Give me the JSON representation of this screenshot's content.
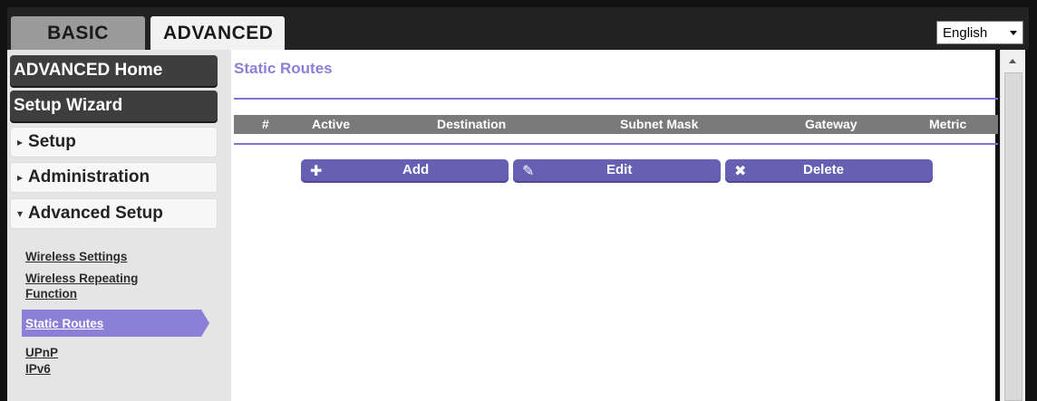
{
  "top_tabs": {
    "basic": "BASIC",
    "advanced": "ADVANCED"
  },
  "language": {
    "selected": "English"
  },
  "sidebar": {
    "advanced_home": "ADVANCED Home",
    "setup_wizard": "Setup Wizard",
    "setup": "Setup",
    "administration": "Administration",
    "advanced_setup": "Advanced Setup",
    "sub_items": [
      {
        "label": "Wireless Settings"
      },
      {
        "label": "Wireless Repeating"
      },
      {
        "label": "Function"
      },
      {
        "label": "Static Routes"
      },
      {
        "label": "UPnP"
      },
      {
        "label": "IPv6"
      }
    ]
  },
  "main": {
    "title": "Static Routes",
    "table_headers": [
      "#",
      "Active",
      "Destination",
      "Subnet Mask",
      "Gateway",
      "Metric"
    ],
    "buttons": {
      "add": "Add",
      "edit": "Edit",
      "delete": "Delete"
    }
  },
  "colors": {
    "accent": "#8c7fd8",
    "button": "#675fb1",
    "nav_dark": "#3e3e3e",
    "table_header": "#7a7a7a"
  }
}
